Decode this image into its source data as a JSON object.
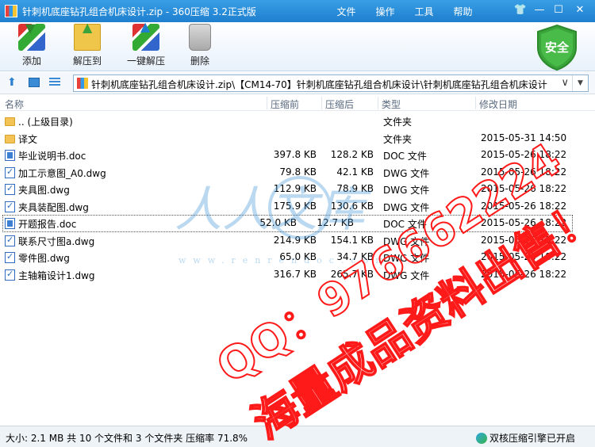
{
  "window": {
    "title": "针刺机底座钻孔组合机床设计.zip - 360压缩 3.2正式版",
    "menu": [
      "文件",
      "操作",
      "工具",
      "帮助"
    ],
    "controls": {
      "skin": "👕",
      "minimize": "—",
      "maximize": "☐",
      "close": "✕"
    }
  },
  "toolbar": {
    "add": "添加",
    "extract_to": "解压到",
    "one_click_extract": "一键解压",
    "delete": "删除",
    "safe_badge": "安全"
  },
  "address": {
    "path": "针刺机底座钻孔组合机床设计.zip\\【CM14-70】针刺机底座钻孔组合机床设计\\针刺机底座钻孔组合机床设计"
  },
  "columns": {
    "name": "名称",
    "original_size": "压缩前",
    "compressed_size": "压缩后",
    "type": "类型",
    "modified": "修改日期"
  },
  "files": [
    {
      "name": ".. (上级目录)",
      "size": "",
      "packed": "",
      "type": "文件夹",
      "date": "",
      "icon": "folder-icon"
    },
    {
      "name": "译文",
      "size": "",
      "packed": "",
      "type": "文件夹",
      "date": "2015-05-31 14:50",
      "icon": "folder-icon"
    },
    {
      "name": "毕业说明书.doc",
      "size": "397.8 KB",
      "packed": "128.2 KB",
      "type": "DOC 文件",
      "date": "2015-05-26 18:22",
      "icon": "doc-file-icon"
    },
    {
      "name": "加工示意图_A0.dwg",
      "size": "79.8 KB",
      "packed": "42.1 KB",
      "type": "DWG 文件",
      "date": "2015-05-26 18:22",
      "icon": "dwg-file-icon"
    },
    {
      "name": "夹具图.dwg",
      "size": "112.9 KB",
      "packed": "78.9 KB",
      "type": "DWG 文件",
      "date": "2015-05-26 18:22",
      "icon": "dwg-file-icon"
    },
    {
      "name": "夹具装配图.dwg",
      "size": "175.9 KB",
      "packed": "130.6 KB",
      "type": "DWG 文件",
      "date": "2015-05-26 18:22",
      "icon": "dwg-file-icon"
    },
    {
      "name": "开题报告.doc",
      "size": "52.0 KB",
      "packed": "12.7 KB",
      "type": "DOC 文件",
      "date": "2015-05-26 18:22",
      "icon": "doc-file-icon"
    },
    {
      "name": "联系尺寸图a.dwg",
      "size": "214.9 KB",
      "packed": "154.1 KB",
      "type": "DWG 文件",
      "date": "2015-05-26 18:22",
      "icon": "dwg-file-icon"
    },
    {
      "name": "零件图.dwg",
      "size": "65.0 KB",
      "packed": "34.7 KB",
      "type": "DWG 文件",
      "date": "2015-05-26 18:22",
      "icon": "dwg-file-icon"
    },
    {
      "name": "主轴箱设计1.dwg",
      "size": "316.7 KB",
      "packed": "265.7 KB",
      "type": "DWG 文件",
      "date": "2015-05-26 18:22",
      "icon": "dwg-file-icon"
    }
  ],
  "status": {
    "summary": "大小: 2.1 MB 共 10 个文件和 3 个文件夹 压缩率 71.8%",
    "engine": "双核压缩引擎已开启"
  },
  "watermark": {
    "logo_text": "人人文库",
    "url": "www.renrendoc.com",
    "qq": "QQ：976662224",
    "slogan": "海量成品资料出售！"
  },
  "colors": {
    "titlebar": "#1e7fce",
    "watermark_red": "#ff1a1a",
    "shield_green": "#3aa43a"
  }
}
